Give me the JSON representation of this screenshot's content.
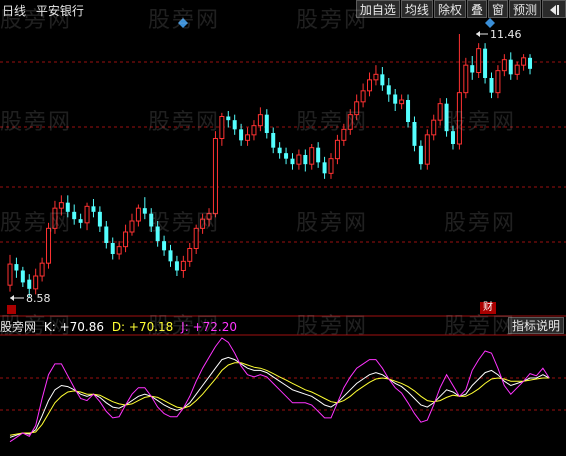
{
  "header": {
    "period": "日线",
    "stock_name": "平安银行"
  },
  "toolbar": {
    "buttons": [
      "加自选",
      "均线",
      "除权",
      "叠",
      "窗",
      "预测"
    ],
    "nav_icon": "play-back-icon"
  },
  "price_panel": {
    "high_label": "11.46",
    "low_label": "8.58",
    "marker_label": "财",
    "up_color": "#ff3232",
    "down_color": "#54ffff"
  },
  "indicator": {
    "name": "股旁网",
    "k_label": "K: +70.86",
    "k_color": "#ffffff",
    "d_label": "D: +70.18",
    "d_color": "#ffff33",
    "j_label": "J: +72.20",
    "j_color": "#ff33ff",
    "button": "指标说明"
  },
  "watermark": "股旁网",
  "chart_data": [
    {
      "type": "candlestick",
      "high_marker": 11.46,
      "low_marker": 8.58,
      "candles": [
        [
          8.72,
          8.95,
          8.65,
          9.05
        ],
        [
          8.95,
          8.88,
          8.8,
          9.02
        ],
        [
          8.88,
          8.75,
          8.7,
          8.92
        ],
        [
          8.78,
          8.68,
          8.58,
          8.84
        ],
        [
          8.68,
          8.82,
          8.62,
          8.9
        ],
        [
          8.82,
          8.96,
          8.76,
          9.02
        ],
        [
          8.96,
          9.34,
          8.9,
          9.4
        ],
        [
          9.34,
          9.56,
          9.28,
          9.64
        ],
        [
          9.56,
          9.62,
          9.48,
          9.7
        ],
        [
          9.62,
          9.52,
          9.46,
          9.7
        ],
        [
          9.52,
          9.44,
          9.38,
          9.6
        ],
        [
          9.44,
          9.4,
          9.34,
          9.5
        ],
        [
          9.4,
          9.58,
          9.32,
          9.62
        ],
        [
          9.58,
          9.52,
          9.46,
          9.66
        ],
        [
          9.52,
          9.36,
          9.3,
          9.58
        ],
        [
          9.36,
          9.18,
          9.12,
          9.42
        ],
        [
          9.18,
          9.06,
          9.0,
          9.24
        ],
        [
          9.06,
          9.14,
          9.0,
          9.2
        ],
        [
          9.14,
          9.3,
          9.08,
          9.38
        ],
        [
          9.3,
          9.42,
          9.26,
          9.5
        ],
        [
          9.42,
          9.56,
          9.36,
          9.6
        ],
        [
          9.56,
          9.5,
          9.44,
          9.68
        ],
        [
          9.5,
          9.36,
          9.3,
          9.56
        ],
        [
          9.36,
          9.2,
          9.14,
          9.42
        ],
        [
          9.2,
          9.1,
          9.04,
          9.26
        ],
        [
          9.1,
          8.98,
          8.92,
          9.16
        ],
        [
          8.98,
          8.88,
          8.82,
          9.04
        ],
        [
          8.88,
          8.98,
          8.8,
          9.04
        ],
        [
          8.98,
          9.12,
          8.92,
          9.18
        ],
        [
          9.12,
          9.34,
          9.06,
          9.38
        ],
        [
          9.34,
          9.44,
          9.28,
          9.5
        ],
        [
          9.44,
          9.5,
          9.36,
          9.56
        ],
        [
          9.5,
          10.32,
          9.46,
          10.4
        ],
        [
          10.32,
          10.56,
          10.24,
          10.6
        ],
        [
          10.56,
          10.52,
          10.44,
          10.62
        ],
        [
          10.52,
          10.42,
          10.36,
          10.58
        ],
        [
          10.42,
          10.3,
          10.24,
          10.48
        ],
        [
          10.3,
          10.36,
          10.24,
          10.44
        ],
        [
          10.36,
          10.46,
          10.3,
          10.52
        ],
        [
          10.46,
          10.58,
          10.4,
          10.66
        ],
        [
          10.58,
          10.38,
          10.32,
          10.64
        ],
        [
          10.38,
          10.22,
          10.16,
          10.44
        ],
        [
          10.22,
          10.16,
          10.1,
          10.28
        ],
        [
          10.16,
          10.1,
          10.04,
          10.22
        ],
        [
          10.1,
          10.04,
          9.98,
          10.16
        ],
        [
          10.04,
          10.14,
          9.98,
          10.2
        ],
        [
          10.14,
          10.04,
          9.96,
          10.2
        ],
        [
          10.04,
          10.22,
          9.98,
          10.26
        ],
        [
          10.22,
          10.06,
          10.0,
          10.28
        ],
        [
          10.06,
          9.94,
          9.88,
          10.12
        ],
        [
          9.94,
          10.1,
          9.88,
          10.16
        ],
        [
          10.1,
          10.3,
          10.04,
          10.36
        ],
        [
          10.3,
          10.42,
          10.24,
          10.48
        ],
        [
          10.42,
          10.58,
          10.36,
          10.64
        ],
        [
          10.58,
          10.72,
          10.52,
          10.8
        ],
        [
          10.72,
          10.84,
          10.66,
          10.92
        ],
        [
          10.84,
          10.96,
          10.78,
          11.04
        ],
        [
          10.96,
          11.02,
          10.9,
          11.12
        ],
        [
          11.02,
          10.9,
          10.84,
          11.1
        ],
        [
          10.9,
          10.8,
          10.72,
          10.98
        ],
        [
          10.8,
          10.7,
          10.62,
          10.86
        ],
        [
          10.7,
          10.74,
          10.64,
          10.8
        ],
        [
          10.74,
          10.5,
          10.44,
          10.8
        ],
        [
          10.5,
          10.24,
          10.18,
          10.56
        ],
        [
          10.24,
          10.04,
          9.98,
          10.3
        ],
        [
          10.04,
          10.36,
          9.98,
          10.42
        ],
        [
          10.36,
          10.52,
          10.3,
          10.58
        ],
        [
          10.52,
          10.7,
          10.46,
          10.76
        ],
        [
          10.7,
          10.4,
          10.34,
          10.76
        ],
        [
          10.4,
          10.26,
          10.2,
          10.46
        ],
        [
          10.26,
          10.82,
          10.2,
          11.46
        ],
        [
          10.82,
          11.12,
          10.76,
          11.2
        ],
        [
          11.12,
          11.04,
          10.96,
          11.22
        ],
        [
          11.04,
          11.3,
          10.98,
          11.36
        ],
        [
          11.3,
          10.98,
          10.92,
          11.36
        ],
        [
          10.98,
          10.82,
          10.76,
          11.04
        ],
        [
          10.82,
          11.06,
          10.76,
          11.12
        ],
        [
          11.06,
          11.18,
          11.0,
          11.24
        ],
        [
          11.18,
          11.02,
          10.96,
          11.26
        ],
        [
          11.02,
          11.12,
          10.96,
          11.16
        ],
        [
          11.12,
          11.2,
          11.06,
          11.24
        ],
        [
          11.2,
          11.08,
          11.02,
          11.24
        ]
      ]
    },
    {
      "type": "line",
      "series": [
        {
          "name": "K",
          "color": "#ffffff",
          "values": [
            8,
            10,
            12,
            11,
            15,
            28,
            42,
            52,
            56,
            55,
            52,
            48,
            46,
            48,
            45,
            40,
            36,
            35,
            38,
            42,
            46,
            48,
            46,
            42,
            38,
            35,
            33,
            35,
            40,
            48,
            56,
            64,
            72,
            80,
            82,
            80,
            76,
            72,
            70,
            70,
            68,
            64,
            60,
            56,
            52,
            50,
            48,
            46,
            42,
            38,
            36,
            40,
            46,
            52,
            58,
            62,
            66,
            68,
            66,
            62,
            58,
            55,
            50,
            44,
            38,
            36,
            40,
            46,
            52,
            50,
            46,
            48,
            56,
            62,
            68,
            70,
            66,
            60,
            56,
            58,
            60,
            63,
            63,
            66,
            63
          ]
        },
        {
          "name": "D",
          "color": "#ffff33",
          "values": [
            10,
            11,
            12,
            12,
            13,
            20,
            30,
            40,
            46,
            50,
            51,
            50,
            48,
            48,
            47,
            44,
            41,
            39,
            38,
            39,
            42,
            45,
            46,
            45,
            42,
            39,
            36,
            35,
            37,
            42,
            48,
            55,
            62,
            70,
            75,
            77,
            77,
            75,
            73,
            72,
            70,
            67,
            64,
            61,
            58,
            55,
            52,
            50,
            47,
            44,
            41,
            40,
            42,
            46,
            51,
            55,
            59,
            62,
            63,
            62,
            60,
            58,
            55,
            51,
            46,
            42,
            41,
            42,
            45,
            47,
            46,
            46,
            49,
            53,
            58,
            62,
            63,
            62,
            60,
            60,
            60,
            61,
            62,
            63,
            63
          ]
        },
        {
          "name": "J",
          "color": "#ff33ff",
          "values": [
            4,
            8,
            12,
            9,
            19,
            44,
            66,
            76,
            76,
            65,
            54,
            44,
            42,
            48,
            41,
            32,
            26,
            27,
            38,
            48,
            54,
            54,
            46,
            36,
            30,
            27,
            27,
            35,
            46,
            60,
            72,
            82,
            92,
            100,
            96,
            86,
            74,
            66,
            64,
            66,
            64,
            58,
            52,
            46,
            40,
            40,
            40,
            38,
            32,
            26,
            26,
            40,
            54,
            64,
            72,
            76,
            80,
            80,
            72,
            62,
            54,
            49,
            40,
            30,
            22,
            24,
            38,
            54,
            66,
            56,
            46,
            52,
            70,
            80,
            88,
            86,
            72,
            56,
            48,
            54,
            60,
            67,
            65,
            72,
            63
          ]
        }
      ]
    }
  ]
}
